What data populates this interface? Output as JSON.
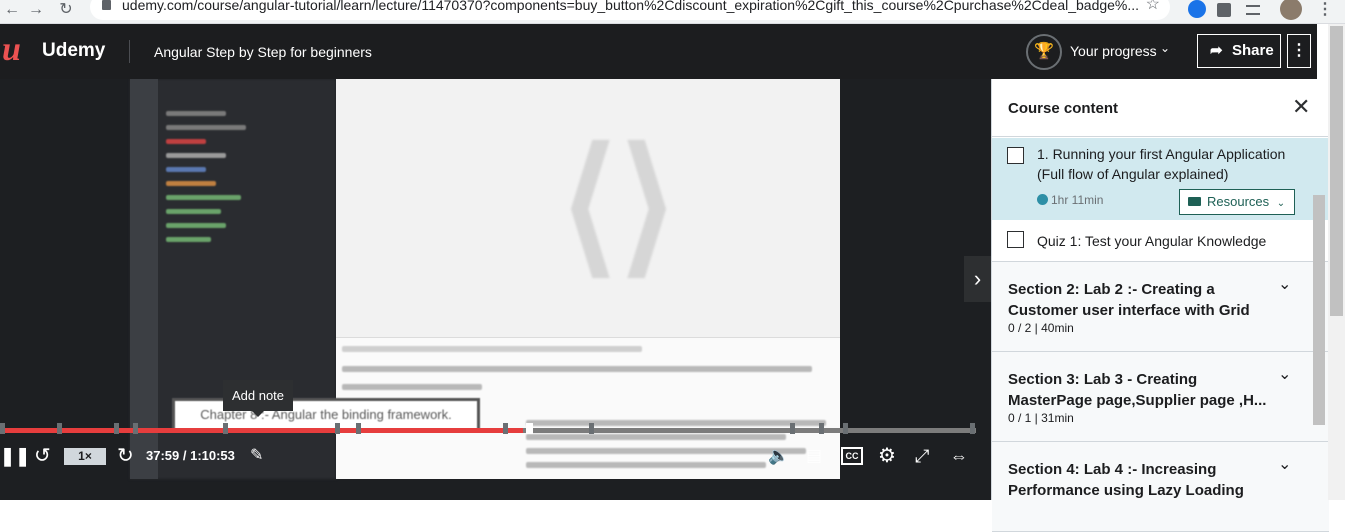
{
  "browser": {
    "url": "udemy.com/course/angular-tutorial/learn/lecture/11470370?components=buy_button%2Cdiscount_expiration%2Cgift_this_course%2Cpurchase%2Cdeal_badge%..."
  },
  "header": {
    "logo_mark": "u",
    "logo_text": "Udemy",
    "course_title": "Angular Step by Step for beginners",
    "progress_label": "Your progress",
    "share_label": "Share"
  },
  "player": {
    "add_note_tooltip": "Add note",
    "caption_text": "Chapter 8 :- Angular the binding framework.",
    "speed": "1×",
    "timecode": "37:59 / 1:10:53",
    "progress_fraction": 0.536,
    "accent_color": "#e63d3d"
  },
  "sidebar": {
    "title": "Course content",
    "lessons": [
      {
        "title": "1. Running your first Angular Application (Full flow of Angular explained)",
        "duration": "1hr 11min",
        "resources_label": "Resources"
      },
      {
        "title": "Quiz 1: Test your Angular Knowledge"
      }
    ],
    "sections": [
      {
        "title": "Section 2: Lab 2 :- Creating a Customer user interface with Grid",
        "meta": "0 / 2 | 40min"
      },
      {
        "title": "Section 3: Lab 3 - Creating MasterPage page,Supplier page ,H...",
        "meta": "0 / 1 | 31min"
      },
      {
        "title": "Section 4: Lab 4 :- Increasing Performance using Lazy Loading",
        "meta": ""
      }
    ]
  },
  "icons": [
    "back-icon",
    "forward-icon",
    "reload-icon",
    "lock-icon",
    "star-icon",
    "trophy-icon",
    "share-icon",
    "more-icon",
    "close-icon",
    "chevron-down-icon",
    "folder-icon",
    "play-icon",
    "rewind-icon",
    "forward-skip-icon",
    "note-icon",
    "volume-icon",
    "transcript-icon",
    "captions-icon",
    "settings-icon",
    "fullscreen-icon",
    "expand-icon",
    "next-icon"
  ]
}
